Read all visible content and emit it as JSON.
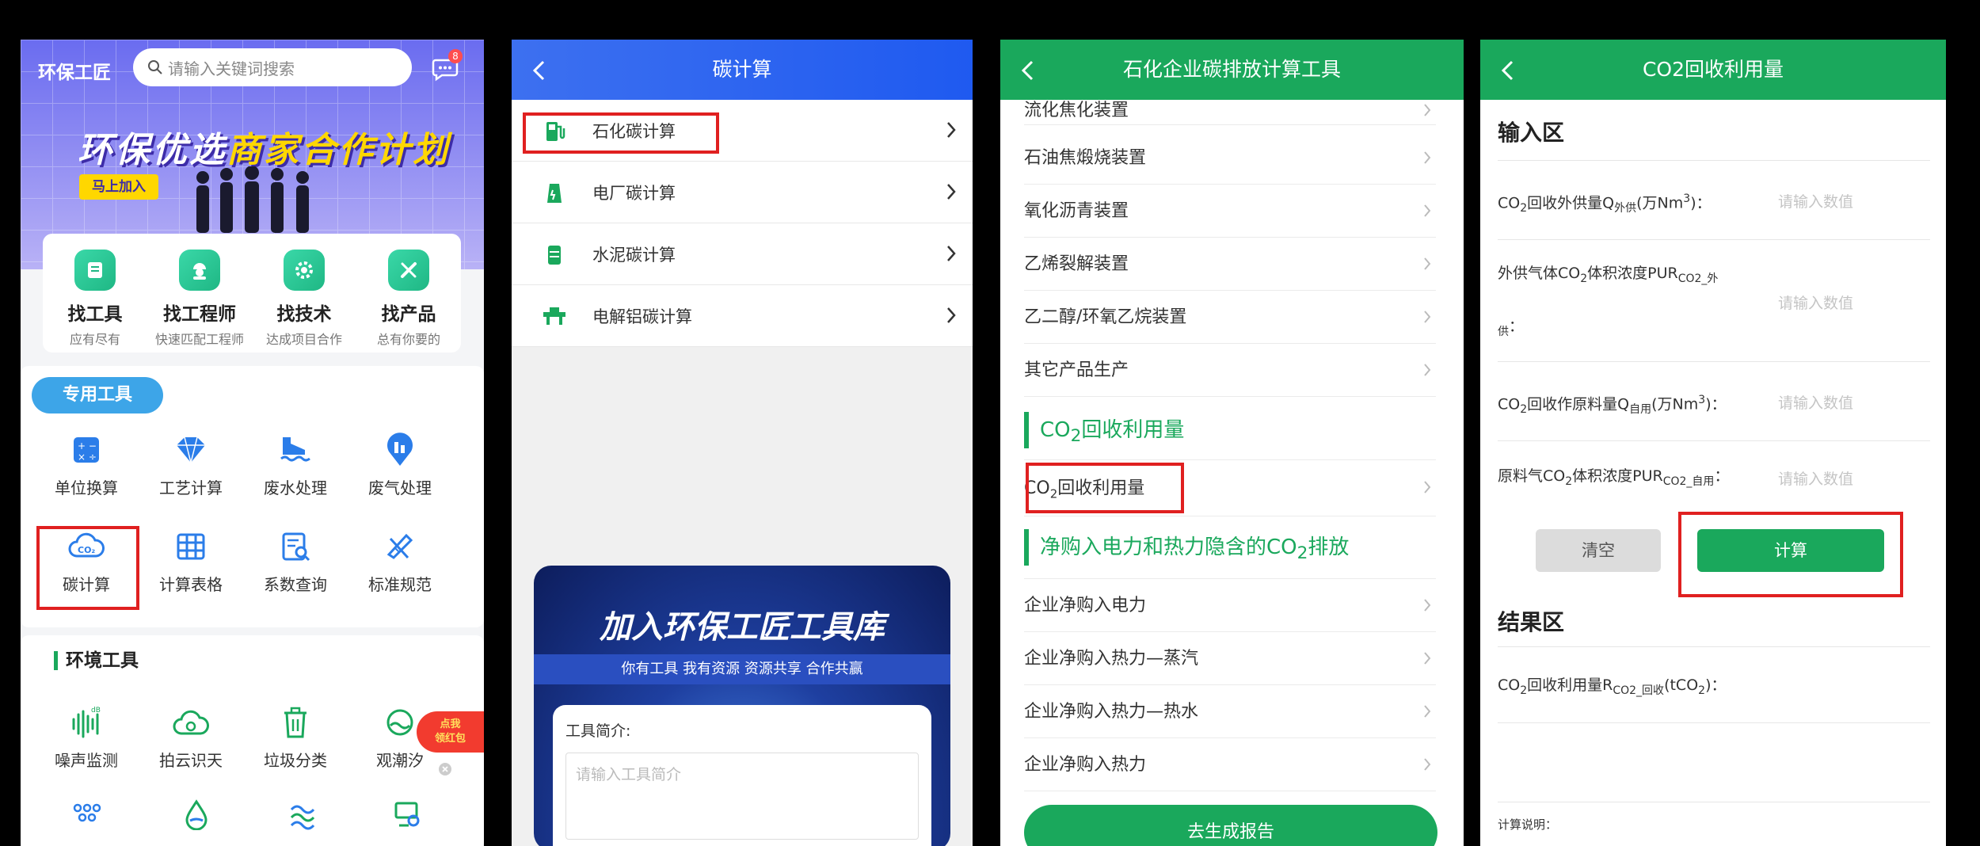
{
  "panel1": {
    "brand": "环保工匠",
    "search_placeholder": "请输入关键词搜索",
    "message_badge": "8",
    "banner": {
      "title_white": "环保优选",
      "title_yellow": "商家合作计划",
      "join_label": "马上加入"
    },
    "cards": [
      {
        "icon": "toolbox-icon",
        "title": "找工具",
        "subtitle": "应有尽有"
      },
      {
        "icon": "engineer-icon",
        "title": "找工程师",
        "subtitle": "快速匹配工程师"
      },
      {
        "icon": "gear-icon",
        "title": "找技术",
        "subtitle": "达成项目合作"
      },
      {
        "icon": "wrench-icon",
        "title": "找产品",
        "subtitle": "总有你要的"
      }
    ],
    "special_tools_label": "专用工具",
    "special_tools": [
      "单位换算",
      "工艺计算",
      "废水处理",
      "废气处理",
      "碳计算",
      "计算表格",
      "系数查询",
      "标准规范"
    ],
    "env_tools_title": "环境工具",
    "env_tools": [
      "噪声监测",
      "拍云识天",
      "垃圾分类",
      "观潮汐"
    ],
    "promo": [
      "点我",
      "领红包"
    ],
    "colors": {
      "accent": "#1aa85c",
      "hero": "#6a6cf0",
      "highlight": "#e02020"
    }
  },
  "panel2": {
    "title": "碳计算",
    "items": [
      {
        "icon": "fuel-pump-icon",
        "label": "石化碳计算"
      },
      {
        "icon": "power-plant-icon",
        "label": "电厂碳计算"
      },
      {
        "icon": "cement-icon",
        "label": "水泥碳计算"
      },
      {
        "icon": "electrolysis-icon",
        "label": "电解铝碳计算"
      }
    ],
    "promo_card": {
      "title": "加入环保工匠工具库",
      "subtitle": "你有工具  我有资源  资源共享  合作共赢",
      "form_label": "工具简介:",
      "form_placeholder": "请输入工具简介"
    }
  },
  "panel3": {
    "title": "石化企业碳排放计算工具",
    "rows_top": [
      "流化焦化装置",
      "石油焦煅烧装置",
      "氧化沥青装置",
      "乙烯裂解装置",
      "乙二醇/环氧乙烷装置",
      "其它产品生产"
    ],
    "section_co2": {
      "prefix": "CO",
      "sub": "2",
      "suffix": "回收利用量"
    },
    "row_co2": {
      "prefix": "CO",
      "sub": "2",
      "suffix": "回收利用量"
    },
    "section_power": {
      "prefix": "净购入电力和热力隐含的CO",
      "sub": "2",
      "suffix": "排放"
    },
    "rows_bottom": [
      "企业净购入电力",
      "企业净购入热力—蒸汽",
      "企业净购入热力—热水",
      "企业净购入热力"
    ],
    "report_button": "去生成报告"
  },
  "panel4": {
    "title": "CO2回收利用量",
    "input_title": "输入区",
    "placeholder": "请输入数值",
    "field1": {
      "a": "CO",
      "b": "2",
      "c": "回收外供量Q",
      "d": "外供",
      "e": "(万Nm",
      "f": "3",
      "g": ")："
    },
    "field2": {
      "a": "外供气体CO",
      "b": "2",
      "c": "体积浓度PUR",
      "d": "CO2_外",
      "e": "供",
      "f": "："
    },
    "field3": {
      "a": "CO",
      "b": "2",
      "c": "回收作原料量Q",
      "d": "自用",
      "e": "(万Nm",
      "f": "3",
      "g": ")："
    },
    "field4": {
      "a": "原料气CO",
      "b": "2",
      "c": "体积浓度PUR",
      "d": "CO2_自用",
      "e": "："
    },
    "clear_button": "清空",
    "calc_button": "计算",
    "result_title": "结果区",
    "result": {
      "a": "CO",
      "b": "2",
      "c": "回收利用量R",
      "d": "CO2_回收",
      "e": "(tCO",
      "f": "2",
      "g": ")："
    },
    "note": "计算说明："
  }
}
